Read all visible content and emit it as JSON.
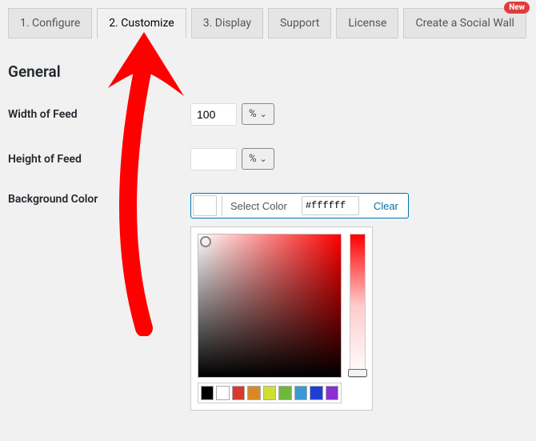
{
  "tabs": {
    "configure": "1. Configure",
    "customize": "2. Customize",
    "display": "3. Display",
    "support": "Support",
    "license": "License",
    "socialwall": "Create a Social Wall"
  },
  "badge_new": "New",
  "section": {
    "general": "General"
  },
  "fields": {
    "width_label": "Width of Feed",
    "width_value": "100",
    "width_unit": "%",
    "height_label": "Height of Feed",
    "height_value": "",
    "height_unit": "%",
    "bgcolor_label": "Background Color",
    "select_color": "Select Color",
    "hex_value": "#ffffff",
    "clear": "Clear"
  },
  "palette": [
    "#000000",
    "#ffffff",
    "#d63b2f",
    "#d98924",
    "#cfe02f",
    "#6fb839",
    "#3a9ad4",
    "#1f3fd4",
    "#8b2fd1"
  ],
  "annotation": {
    "color": "#ff0000"
  }
}
